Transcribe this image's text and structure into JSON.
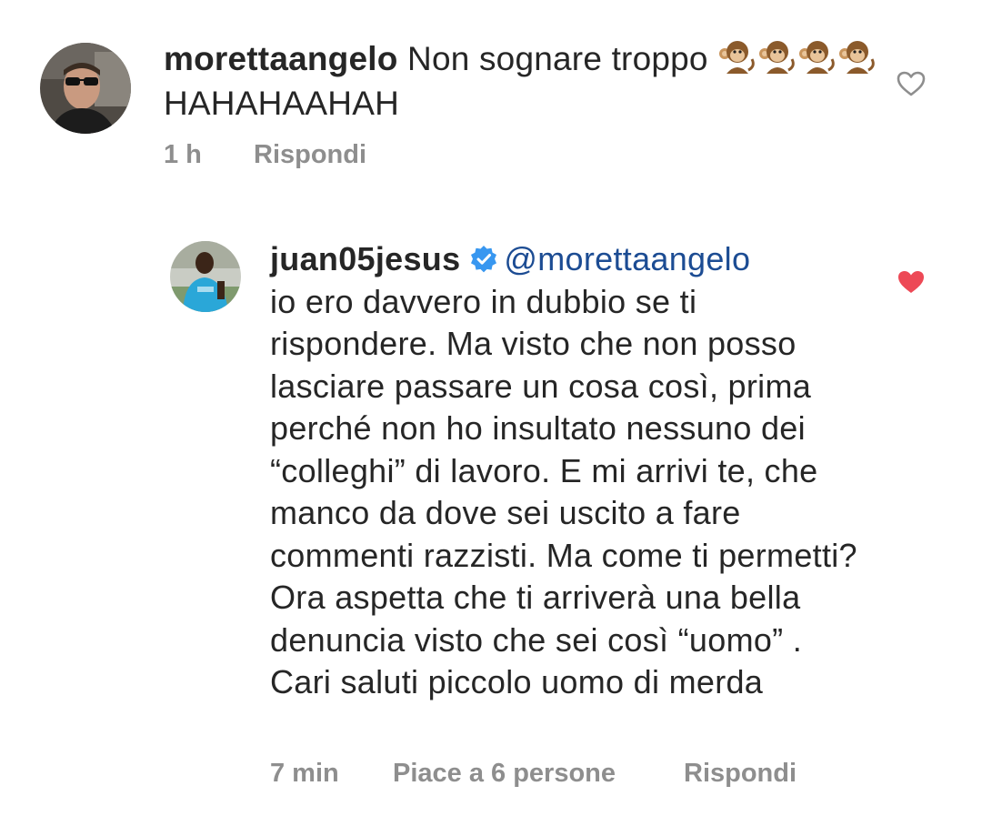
{
  "comment_1": {
    "username": "morettaangelo",
    "text_before_emoji": "Non sognare troppo",
    "emoji": "monkey-emoji",
    "text_after_emoji": "HAHAHAAHAH",
    "time": "1 h",
    "reply_label": "Rispondi",
    "liked": false
  },
  "comment_2": {
    "username": "juan05jesus",
    "verified": true,
    "mention": "@morettaangelo",
    "text": "io ero davvero in dubbio se ti rispondere. Ma visto che non posso lasciare passare un cosa così, prima perché non ho insultato nessuno dei “colleghi” di lavoro. E mi arrivi te, che manco da dove sei uscito a fare commenti razzisti. Ma come ti permetti? Ora aspetta che ti  arriverà una bella denuncia visto che sei così “uomo” . Cari saluti piccolo uomo di merda",
    "time": "7 min",
    "likes_label": "Piace a 6 persone",
    "reply_label": "Rispondi",
    "liked": true
  },
  "colors": {
    "text": "#262626",
    "meta": "#8e8e8e",
    "mention": "#1c4c93",
    "verified": "#3897f0",
    "heart_liked": "#ed4956",
    "heart_outline": "#8e8e8e"
  }
}
